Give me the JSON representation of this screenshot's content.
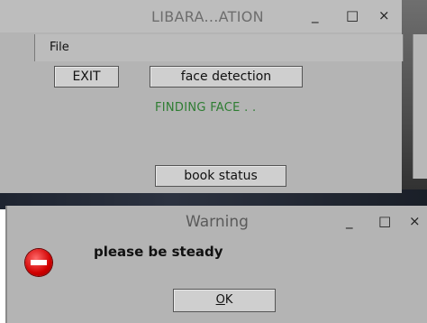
{
  "main_window": {
    "title": "LIBARA...ATION",
    "controls": {
      "minimize": "_",
      "maximize": "□",
      "close": "×"
    },
    "menu": {
      "file": "File"
    },
    "buttons": {
      "exit": "EXIT",
      "face_detection": "face detection",
      "book_status": "book status"
    },
    "status_text": "FINDING FACE . ."
  },
  "dialog": {
    "title": "Warning",
    "controls": {
      "minimize": "_",
      "maximize": "□",
      "close": "×"
    },
    "message": "please be steady",
    "ok_label_first": "O",
    "ok_label_rest": "K",
    "icon": "error-icon"
  },
  "colors": {
    "window_bg": "#b4b4b4",
    "status_green": "#2e7d32",
    "error_red": "#d10000"
  }
}
